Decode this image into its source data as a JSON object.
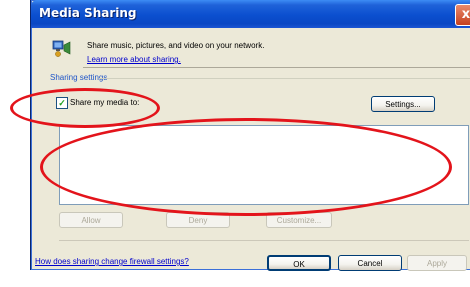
{
  "window": {
    "title": "Media Sharing",
    "close_glyph": "x"
  },
  "header": {
    "icon": "media-sharing-icon",
    "description": "Share music, pictures, and video on your network.",
    "learn_more_link": "Learn more about sharing."
  },
  "sharing_settings": {
    "group_label": "Sharing settings",
    "share_checkbox_label": "Share my media to:",
    "share_checked": true,
    "settings_button": "Settings..."
  },
  "device_buttons": {
    "allow": "Allow",
    "deny": "Deny",
    "customize": "Customize..."
  },
  "footer": {
    "firewall_link": "How does sharing change firewall settings?",
    "ok": "OK",
    "cancel": "Cancel",
    "apply": "Apply"
  },
  "annotations": {
    "color": "#e3141b"
  }
}
